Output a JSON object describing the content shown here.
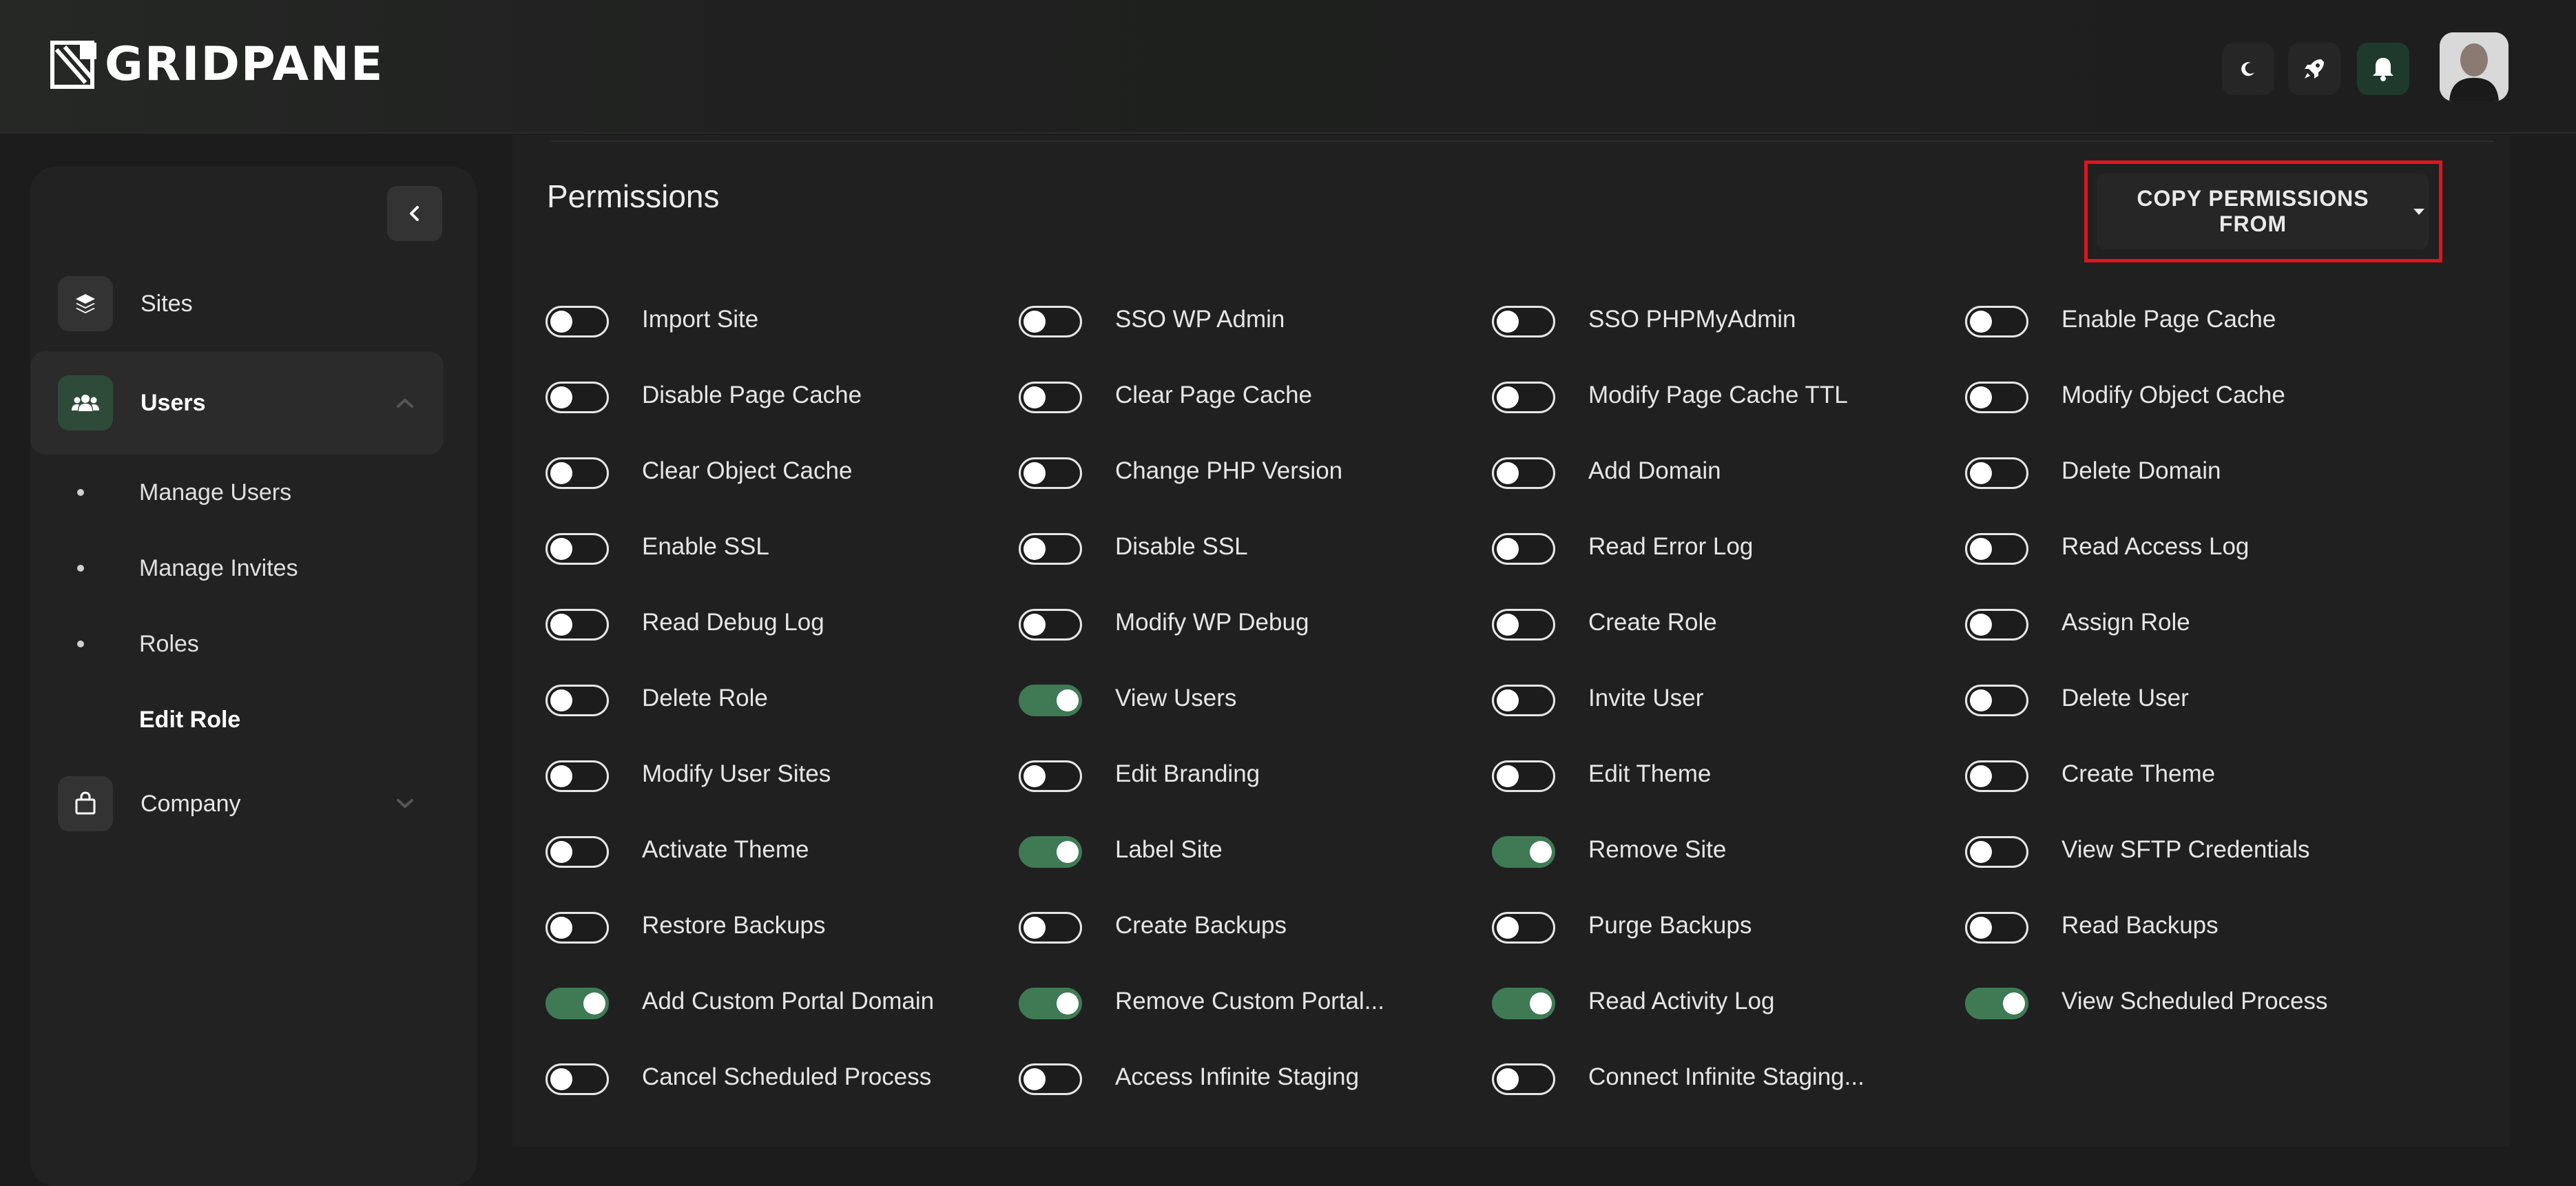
{
  "header": {
    "logo_text": "GRIDPANE",
    "icons": [
      "moon-icon",
      "rocket-icon",
      "bell-icon"
    ],
    "avatar": "user-avatar"
  },
  "sidebar": {
    "collapse_icon": "chevron-left-icon",
    "items": [
      {
        "label": "Sites",
        "icon": "layers-icon"
      },
      {
        "label": "Users",
        "icon": "users-icon",
        "expanded": true
      },
      {
        "label": "Company",
        "icon": "bag-icon",
        "expanded": false
      }
    ],
    "sub_items": [
      {
        "label": "Manage Users"
      },
      {
        "label": "Manage Invites"
      },
      {
        "label": "Roles"
      },
      {
        "label": "Edit Role",
        "current": true
      }
    ]
  },
  "main": {
    "title": "Permissions",
    "copy_button": "COPY PERMISSIONS FROM",
    "permissions": [
      {
        "label": "Import Site",
        "on": false
      },
      {
        "label": "SSO WP Admin",
        "on": false
      },
      {
        "label": "SSO PHPMyAdmin",
        "on": false
      },
      {
        "label": "Enable Page Cache",
        "on": false
      },
      {
        "label": "Disable Page Cache",
        "on": false
      },
      {
        "label": "Clear Page Cache",
        "on": false
      },
      {
        "label": "Modify Page Cache TTL",
        "on": false
      },
      {
        "label": "Modify Object Cache",
        "on": false
      },
      {
        "label": "Clear Object Cache",
        "on": false
      },
      {
        "label": "Change PHP Version",
        "on": false
      },
      {
        "label": "Add Domain",
        "on": false
      },
      {
        "label": "Delete Domain",
        "on": false
      },
      {
        "label": "Enable SSL",
        "on": false
      },
      {
        "label": "Disable SSL",
        "on": false
      },
      {
        "label": "Read Error Log",
        "on": false
      },
      {
        "label": "Read Access Log",
        "on": false
      },
      {
        "label": "Read Debug Log",
        "on": false
      },
      {
        "label": "Modify WP Debug",
        "on": false
      },
      {
        "label": "Create Role",
        "on": false
      },
      {
        "label": "Assign Role",
        "on": false
      },
      {
        "label": "Delete Role",
        "on": false
      },
      {
        "label": "View Users",
        "on": true
      },
      {
        "label": "Invite User",
        "on": false
      },
      {
        "label": "Delete User",
        "on": false
      },
      {
        "label": "Modify User Sites",
        "on": false
      },
      {
        "label": "Edit Branding",
        "on": false
      },
      {
        "label": "Edit Theme",
        "on": false
      },
      {
        "label": "Create Theme",
        "on": false
      },
      {
        "label": "Activate Theme",
        "on": false
      },
      {
        "label": "Label Site",
        "on": true
      },
      {
        "label": "Remove Site",
        "on": true
      },
      {
        "label": "View SFTP Credentials",
        "on": false
      },
      {
        "label": "Restore Backups",
        "on": false
      },
      {
        "label": "Create Backups",
        "on": false
      },
      {
        "label": "Purge Backups",
        "on": false
      },
      {
        "label": "Read Backups",
        "on": false
      },
      {
        "label": "Add Custom Portal Domain",
        "on": true
      },
      {
        "label": "Remove Custom Portal...",
        "on": true
      },
      {
        "label": "Read Activity Log",
        "on": true
      },
      {
        "label": "View Scheduled Process",
        "on": true
      },
      {
        "label": "Cancel Scheduled Process",
        "on": false
      },
      {
        "label": "Access Infinite Staging",
        "on": false
      },
      {
        "label": "Connect Infinite Staging...",
        "on": false
      }
    ]
  },
  "colors": {
    "accent_green": "#3f7a55",
    "highlight_red": "#e1141e",
    "background": "#1c1c1c"
  }
}
